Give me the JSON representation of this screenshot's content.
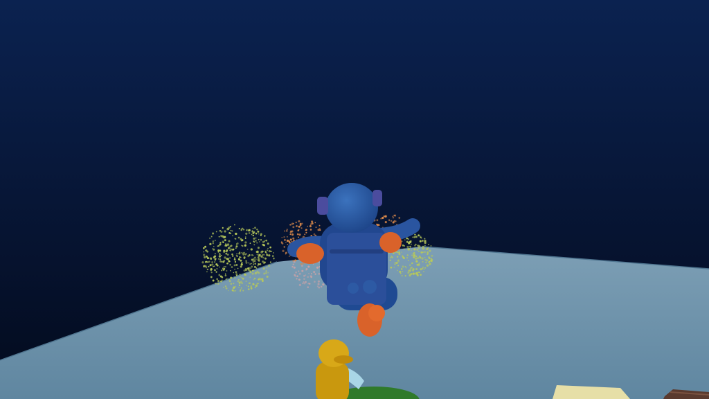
{
  "scene": {
    "colors": {
      "sky_top": "#0b2250",
      "sky_bottom": "#030a1c",
      "floor": "#6e93ab",
      "floor_edge": "#5a7d96",
      "player_body": "#21478f",
      "player_head": "#2a5aa4",
      "player_hands": "#d9622a",
      "firework_green": "#b7c85a",
      "firework_orange": "#d9884a",
      "firework_pink": "#c9a2a8",
      "bystander_yellow": "#c9980e",
      "grass": "#2f7a2a",
      "cushion": "#e6dfa7",
      "crate": "#5a3a2e"
    },
    "objects": [
      "main-player",
      "firework-burst-green",
      "firework-burst-orange",
      "firework-burst-right",
      "yellow-bystander",
      "grass-patch",
      "cushion-block",
      "wooden-crate"
    ]
  }
}
